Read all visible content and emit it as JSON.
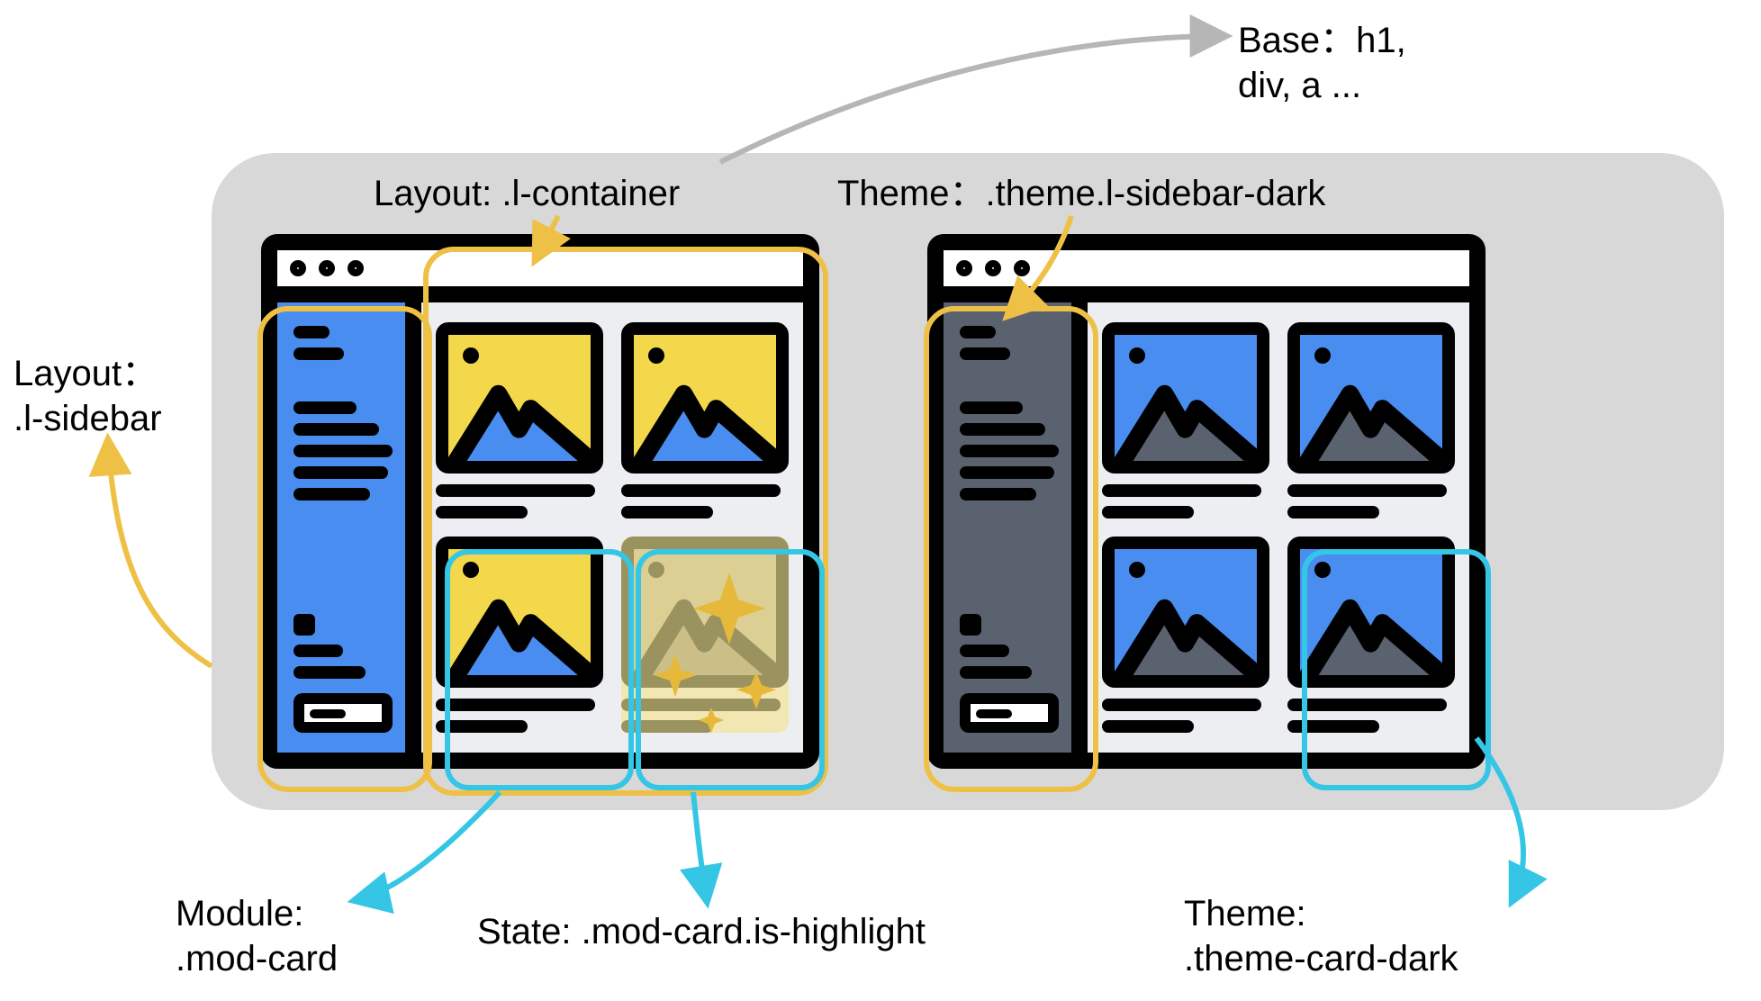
{
  "labels": {
    "base": "Base：h1,\ndiv, a ...",
    "layout_container": "Layout: .l-container",
    "theme_sidebar_dark": "Theme：.theme.l-sidebar-dark",
    "layout_sidebar": "Layout：\n.l-sidebar",
    "module_card": "Module:\n.mod-card",
    "state_highlight": "State: .mod-card.is-highlight",
    "theme_card_dark": "Theme:\n.theme-card-dark"
  },
  "colors": {
    "accent_yellow": "#eec146",
    "accent_cyan": "#35c6e6",
    "accent_grey": "#b6b6b6",
    "sidebar_light": "#4a8df0",
    "sidebar_dark": "#5a6270",
    "card_yellow": "#f3d84b",
    "card_blue": "#4a8df0"
  },
  "icons": {
    "mountain": "mountain-icon",
    "sparkle": "sparkle-icon",
    "image": "image-icon"
  }
}
